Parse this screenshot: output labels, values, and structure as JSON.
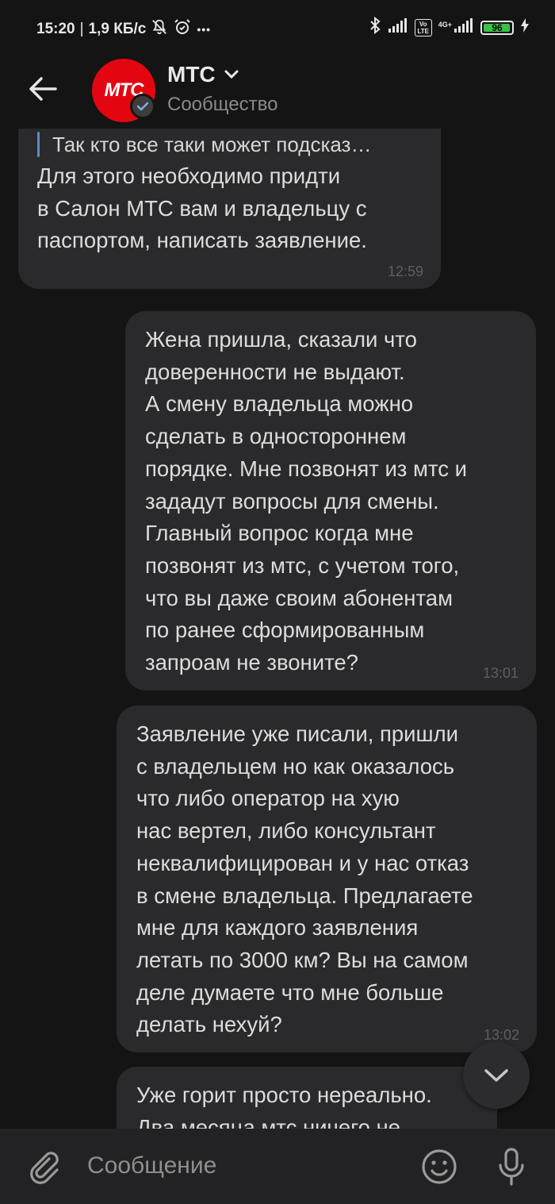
{
  "status_bar": {
    "time": "15:20",
    "speed": "1,9 КБ/с",
    "separator": "|",
    "dots": "•••",
    "network_4g": "4G+",
    "volte": "Vo LTE",
    "battery": "96",
    "battery_level": 0.96,
    "battery_color": "#38c248"
  },
  "header": {
    "title": "МТС",
    "subtitle": "Сообщество",
    "avatar_text": "МТС",
    "avatar_color": "#e30611",
    "icons": [
      "back-arrow-icon",
      "chevron-down-icon",
      "verified-check-icon"
    ]
  },
  "messages": [
    {
      "reply_quote": "Так кто все таки может подсказ…",
      "lines": [
        "Для этого необходимо придти",
        "в Салон МТС вам и владельцу с",
        "паспортом, написать заявление."
      ],
      "time": "12:59"
    },
    {
      "lines": [
        "Жена пришла, сказали что",
        "доверенности не выдают.",
        "А смену владельца можно",
        "сделать в одностороннем",
        "порядке. Мне позвонят из мтс и",
        "зададут вопросы для смены.",
        "Главный вопрос когда мне",
        "позвонят из мтс, с учетом того,",
        "что вы даже своим абонентам",
        "по ранее сформированным",
        "запроам не звоните?"
      ],
      "time": "13:01"
    },
    {
      "lines": [
        "Заявление уже писали, пришли",
        "с владельцем но как оказалось",
        "что либо оператор на хую",
        "нас вертел, либо консультант",
        "неквалифицирован и у нас отказ",
        "в смене владельца. Предлагаете",
        "мне для каждого заявления",
        "летать по 3000 км? Вы на самом",
        "деле думаете что мне больше",
        "делать нехуй?"
      ],
      "time": "13:02"
    },
    {
      "lines": [
        "Уже горит просто нереально.",
        "Два месяца мтс ничего не"
      ]
    }
  ],
  "composer": {
    "placeholder": "Сообщение",
    "icons": [
      "attach-icon",
      "emoji-icon",
      "microphone-icon"
    ]
  },
  "colors": {
    "background": "#141414",
    "bubble": "#2a2a2c",
    "composer": "#222224",
    "reply_bar": "#5b8cc7"
  }
}
